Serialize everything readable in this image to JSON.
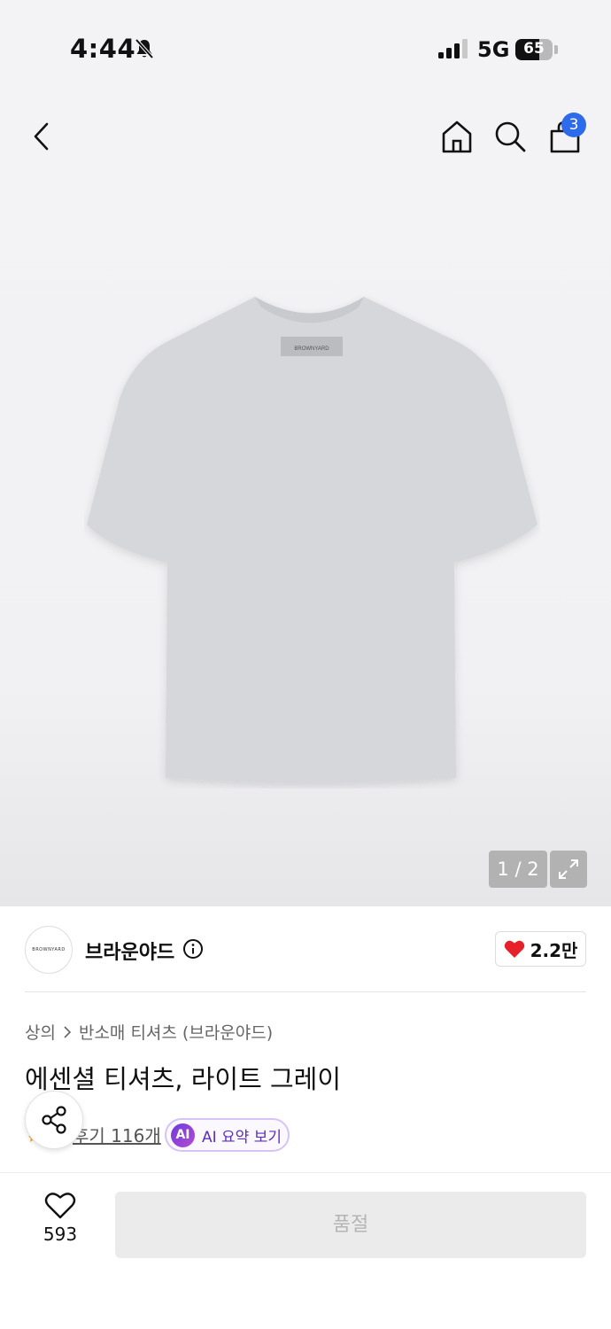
{
  "status_bar": {
    "time": "4:44",
    "network": "5G",
    "battery_percent": "65",
    "battery_level": 0.65,
    "icons": [
      "bell-muted-icon",
      "signal-icon"
    ]
  },
  "nav": {
    "icons": [
      "chevron-left-icon",
      "home-icon",
      "search-icon",
      "shopping-bag-icon"
    ],
    "cart_count": "3"
  },
  "gallery": {
    "image_desc": "light gray t-shirt",
    "neck_label": "BROWNYARD",
    "page_indicator": "1 / 2",
    "expand_icon": "expand-icon"
  },
  "brand": {
    "logo_text": "BROWNYARD",
    "name": "브라운야드",
    "like_count": "2.2만",
    "heart_color": "#e8202a"
  },
  "product": {
    "breadcrumb": [
      "상의",
      "반소매 티셔츠 (브라운야드)"
    ],
    "title": "에센셜 티셔츠, 라이트 그레이",
    "review_link": "후기 116개",
    "ai_badge": "AI",
    "ai_summary_label": "AI 요약 보기"
  },
  "bottom_bar": {
    "wish_count": "593",
    "soldout_label": "품절"
  }
}
